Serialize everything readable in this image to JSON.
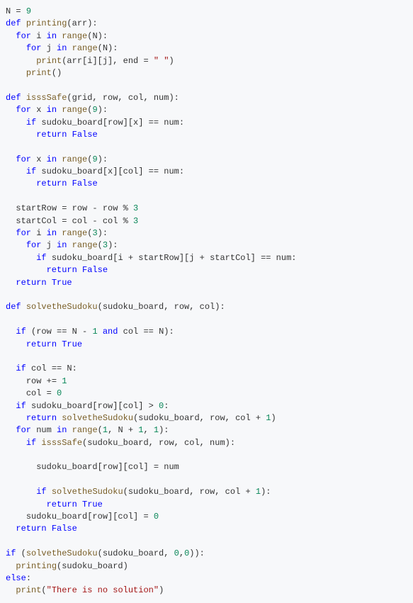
{
  "code_tokens": [
    [
      [
        "id",
        "N"
      ],
      [
        "op",
        " = "
      ],
      [
        "num",
        "9"
      ]
    ],
    [
      [
        "kw",
        "def"
      ],
      [
        "sp",
        " "
      ],
      [
        "fn",
        "printing"
      ],
      [
        "op",
        "(arr):"
      ]
    ],
    [
      [
        "ind",
        "  "
      ],
      [
        "kw",
        "for"
      ],
      [
        "sp",
        " "
      ],
      [
        "id",
        "i "
      ],
      [
        "kw",
        "in"
      ],
      [
        "sp",
        " "
      ],
      [
        "fn",
        "range"
      ],
      [
        "op",
        "(N):"
      ]
    ],
    [
      [
        "ind",
        "    "
      ],
      [
        "kw",
        "for"
      ],
      [
        "sp",
        " "
      ],
      [
        "id",
        "j "
      ],
      [
        "kw",
        "in"
      ],
      [
        "sp",
        " "
      ],
      [
        "fn",
        "range"
      ],
      [
        "op",
        "(N):"
      ]
    ],
    [
      [
        "ind",
        "      "
      ],
      [
        "fn",
        "print"
      ],
      [
        "op",
        "(arr[i][j], end = "
      ],
      [
        "str",
        "\" \""
      ],
      [
        "op",
        ")"
      ]
    ],
    [
      [
        "ind",
        "    "
      ],
      [
        "fn",
        "print"
      ],
      [
        "op",
        "()"
      ]
    ],
    [],
    [
      [
        "kw",
        "def"
      ],
      [
        "sp",
        " "
      ],
      [
        "fn",
        "isssSafe"
      ],
      [
        "op",
        "(grid, row, col, num):"
      ]
    ],
    [
      [
        "ind",
        "  "
      ],
      [
        "kw",
        "for"
      ],
      [
        "sp",
        " "
      ],
      [
        "id",
        "x "
      ],
      [
        "kw",
        "in"
      ],
      [
        "sp",
        " "
      ],
      [
        "fn",
        "range"
      ],
      [
        "op",
        "("
      ],
      [
        "num",
        "9"
      ],
      [
        "op",
        "):"
      ]
    ],
    [
      [
        "ind",
        "    "
      ],
      [
        "kw",
        "if"
      ],
      [
        "sp",
        " "
      ],
      [
        "id",
        "sudoku_board[row][x] == num:"
      ]
    ],
    [
      [
        "ind",
        "      "
      ],
      [
        "kw",
        "return"
      ],
      [
        "sp",
        " "
      ],
      [
        "bool",
        "False"
      ]
    ],
    [],
    [
      [
        "ind",
        "  "
      ],
      [
        "kw",
        "for"
      ],
      [
        "sp",
        " "
      ],
      [
        "id",
        "x "
      ],
      [
        "kw",
        "in"
      ],
      [
        "sp",
        " "
      ],
      [
        "fn",
        "range"
      ],
      [
        "op",
        "("
      ],
      [
        "num",
        "9"
      ],
      [
        "op",
        "):"
      ]
    ],
    [
      [
        "ind",
        "    "
      ],
      [
        "kw",
        "if"
      ],
      [
        "sp",
        " "
      ],
      [
        "id",
        "sudoku_board[x][col] == num:"
      ]
    ],
    [
      [
        "ind",
        "      "
      ],
      [
        "kw",
        "return"
      ],
      [
        "sp",
        " "
      ],
      [
        "bool",
        "False"
      ]
    ],
    [],
    [
      [
        "ind",
        "  "
      ],
      [
        "id",
        "startRow = row - row % "
      ],
      [
        "num",
        "3"
      ]
    ],
    [
      [
        "ind",
        "  "
      ],
      [
        "id",
        "startCol = col - col % "
      ],
      [
        "num",
        "3"
      ]
    ],
    [
      [
        "ind",
        "  "
      ],
      [
        "kw",
        "for"
      ],
      [
        "sp",
        " "
      ],
      [
        "id",
        "i "
      ],
      [
        "kw",
        "in"
      ],
      [
        "sp",
        " "
      ],
      [
        "fn",
        "range"
      ],
      [
        "op",
        "("
      ],
      [
        "num",
        "3"
      ],
      [
        "op",
        "):"
      ]
    ],
    [
      [
        "ind",
        "    "
      ],
      [
        "kw",
        "for"
      ],
      [
        "sp",
        " "
      ],
      [
        "id",
        "j "
      ],
      [
        "kw",
        "in"
      ],
      [
        "sp",
        " "
      ],
      [
        "fn",
        "range"
      ],
      [
        "op",
        "("
      ],
      [
        "num",
        "3"
      ],
      [
        "op",
        "):"
      ]
    ],
    [
      [
        "ind",
        "      "
      ],
      [
        "kw",
        "if"
      ],
      [
        "sp",
        " "
      ],
      [
        "id",
        "sudoku_board[i + startRow][j + startCol] == num:"
      ]
    ],
    [
      [
        "ind",
        "        "
      ],
      [
        "kw",
        "return"
      ],
      [
        "sp",
        " "
      ],
      [
        "bool",
        "False"
      ]
    ],
    [
      [
        "ind",
        "  "
      ],
      [
        "kw",
        "return"
      ],
      [
        "sp",
        " "
      ],
      [
        "bool",
        "True"
      ]
    ],
    [],
    [
      [
        "kw",
        "def"
      ],
      [
        "sp",
        " "
      ],
      [
        "fn",
        "solvetheSudoku"
      ],
      [
        "op",
        "(sudoku_board, row, col):"
      ]
    ],
    [],
    [
      [
        "ind",
        "  "
      ],
      [
        "kw",
        "if"
      ],
      [
        "sp",
        " "
      ],
      [
        "op",
        "(row == N - "
      ],
      [
        "num",
        "1"
      ],
      [
        "sp",
        " "
      ],
      [
        "kw",
        "and"
      ],
      [
        "sp",
        " "
      ],
      [
        "op",
        "col == N):"
      ]
    ],
    [
      [
        "ind",
        "    "
      ],
      [
        "kw",
        "return"
      ],
      [
        "sp",
        " "
      ],
      [
        "bool",
        "True"
      ]
    ],
    [],
    [
      [
        "ind",
        "  "
      ],
      [
        "kw",
        "if"
      ],
      [
        "sp",
        " "
      ],
      [
        "id",
        "col == N:"
      ]
    ],
    [
      [
        "ind",
        "    "
      ],
      [
        "id",
        "row += "
      ],
      [
        "num",
        "1"
      ]
    ],
    [
      [
        "ind",
        "    "
      ],
      [
        "id",
        "col = "
      ],
      [
        "num",
        "0"
      ]
    ],
    [
      [
        "ind",
        "  "
      ],
      [
        "kw",
        "if"
      ],
      [
        "sp",
        " "
      ],
      [
        "id",
        "sudoku_board[row][col] > "
      ],
      [
        "num",
        "0"
      ],
      [
        "op",
        ":"
      ]
    ],
    [
      [
        "ind",
        "    "
      ],
      [
        "kw",
        "return"
      ],
      [
        "sp",
        " "
      ],
      [
        "fn",
        "solvetheSudoku"
      ],
      [
        "op",
        "(sudoku_board, row, col + "
      ],
      [
        "num",
        "1"
      ],
      [
        "op",
        ")"
      ]
    ],
    [
      [
        "ind",
        "  "
      ],
      [
        "kw",
        "for"
      ],
      [
        "sp",
        " "
      ],
      [
        "id",
        "num "
      ],
      [
        "kw",
        "in"
      ],
      [
        "sp",
        " "
      ],
      [
        "fn",
        "range"
      ],
      [
        "op",
        "("
      ],
      [
        "num",
        "1"
      ],
      [
        "op",
        ", N + "
      ],
      [
        "num",
        "1"
      ],
      [
        "op",
        ", "
      ],
      [
        "num",
        "1"
      ],
      [
        "op",
        "):"
      ]
    ],
    [
      [
        "ind",
        "    "
      ],
      [
        "kw",
        "if"
      ],
      [
        "sp",
        " "
      ],
      [
        "fn",
        "isssSafe"
      ],
      [
        "op",
        "(sudoku_board, row, col, num):"
      ]
    ],
    [],
    [
      [
        "ind",
        "      "
      ],
      [
        "id",
        "sudoku_board[row][col] = num"
      ]
    ],
    [],
    [
      [
        "ind",
        "      "
      ],
      [
        "kw",
        "if"
      ],
      [
        "sp",
        " "
      ],
      [
        "fn",
        "solvetheSudoku"
      ],
      [
        "op",
        "(sudoku_board, row, col + "
      ],
      [
        "num",
        "1"
      ],
      [
        "op",
        "):"
      ]
    ],
    [
      [
        "ind",
        "        "
      ],
      [
        "kw",
        "return"
      ],
      [
        "sp",
        " "
      ],
      [
        "bool",
        "True"
      ]
    ],
    [
      [
        "ind",
        "    "
      ],
      [
        "id",
        "sudoku_board[row][col] = "
      ],
      [
        "num",
        "0"
      ]
    ],
    [
      [
        "ind",
        "  "
      ],
      [
        "kw",
        "return"
      ],
      [
        "sp",
        " "
      ],
      [
        "bool",
        "False"
      ]
    ],
    [],
    [
      [
        "kw",
        "if"
      ],
      [
        "sp",
        " "
      ],
      [
        "op",
        "("
      ],
      [
        "fn",
        "solvetheSudoku"
      ],
      [
        "op",
        "(sudoku_board, "
      ],
      [
        "num",
        "0"
      ],
      [
        "op",
        ","
      ],
      [
        "num",
        "0"
      ],
      [
        "op",
        ")):"
      ]
    ],
    [
      [
        "ind",
        "  "
      ],
      [
        "fn",
        "printing"
      ],
      [
        "op",
        "(sudoku_board)"
      ]
    ],
    [
      [
        "kw",
        "else"
      ],
      [
        "op",
        ":"
      ]
    ],
    [
      [
        "ind",
        "  "
      ],
      [
        "fn",
        "print"
      ],
      [
        "op",
        "("
      ],
      [
        "str",
        "\"There is no solution\""
      ],
      [
        "op",
        ")"
      ]
    ]
  ]
}
